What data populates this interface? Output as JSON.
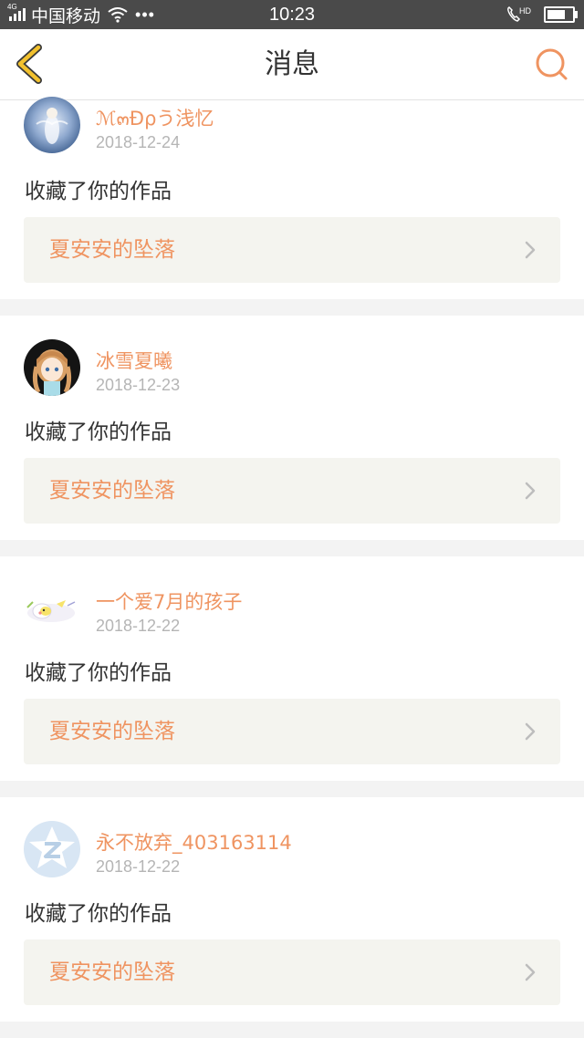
{
  "status_bar": {
    "network": "4G",
    "carrier": "中国移动",
    "dots": "•••",
    "time": "10:23",
    "hd": "HD",
    "battery_level": 0.85
  },
  "header": {
    "title": "消息"
  },
  "notifications": [
    {
      "username": "ℳ๓Ðρう浅忆",
      "date": "2018-12-24",
      "action": "收藏了你的作品",
      "work_title": "夏安安的坠落"
    },
    {
      "username": "冰雪夏曦",
      "date": "2018-12-23",
      "action": "收藏了你的作品",
      "work_title": "夏安安的坠落"
    },
    {
      "username": "一个爱7月的孩子",
      "date": "2018-12-22",
      "action": "收藏了你的作品",
      "work_title": "夏安安的坠落"
    },
    {
      "username": "永不放弃_403163114",
      "date": "2018-12-22",
      "action": "收藏了你的作品",
      "work_title": "夏安安的坠落"
    }
  ],
  "colors": {
    "accent": "#ef9461",
    "back_arrow": "#f2c12e",
    "work_bg": "#f4f4ef"
  }
}
